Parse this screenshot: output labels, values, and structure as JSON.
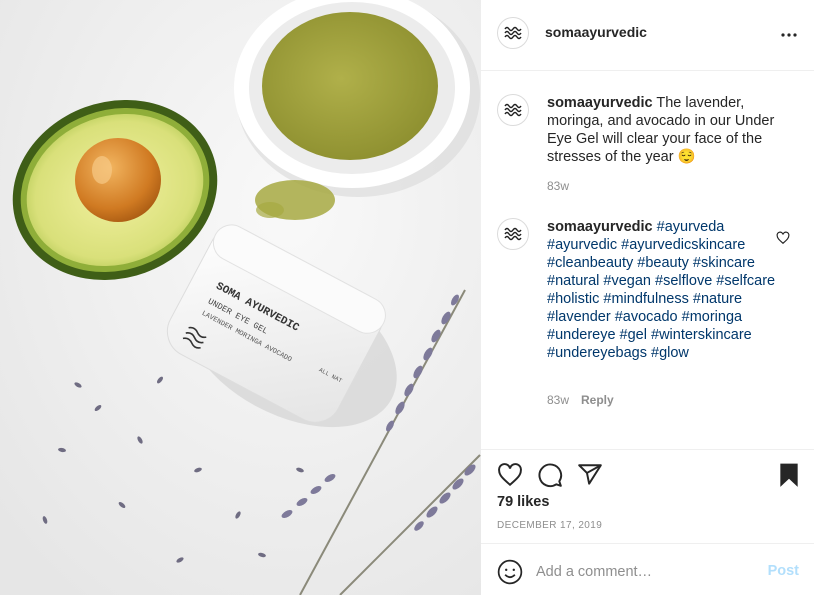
{
  "post": {
    "image_alt_brand": "SOMA AYURVEDIC",
    "image_product_line1": "UNDER EYE GEL",
    "image_product_line2": "LAVENDER  MORINGA  AVOCADO",
    "image_jar_side": "ALL NAT",
    "icons": {
      "avatar": "wave-logo-icon",
      "more": "more-options-icon",
      "like": "heart-icon",
      "comment": "comment-bubble-icon",
      "share": "paper-plane-icon",
      "save": "bookmark-icon",
      "emoji": "emoji-icon",
      "comment_like": "heart-icon"
    }
  },
  "header": {
    "username": "somaayurvedic"
  },
  "caption": {
    "username": "somaayurvedic",
    "text": "The lavender, moringa, and avocado in our Under Eye Gel will clear your face of the stresses of the year 😌",
    "age": "83w"
  },
  "comment": {
    "username": "somaayurvedic",
    "hashtags": "#ayurveda #ayurvedic #ayurvedicskincare #cleanbeauty #beauty #skincare #natural #vegan #selflove #selfcare #holistic #mindfulness #nature #lavender #avocado #moringa #undereye #gel #winterskincare #undereyebags #glow",
    "age": "83w",
    "reply_label": "Reply"
  },
  "engagement": {
    "likes": "79 likes",
    "date": "DECEMBER 17, 2019"
  },
  "add_comment": {
    "placeholder": "Add a comment…",
    "post_label": "Post"
  },
  "colors": {
    "link": "#00376b",
    "muted": "#8e8e8e",
    "post_disabled": "#b2dffc",
    "border": "#efefef"
  }
}
